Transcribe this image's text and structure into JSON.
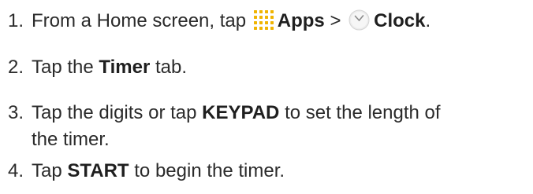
{
  "steps": [
    {
      "number": "1.",
      "text_before": "From a Home screen, tap",
      "apps_icon": "apps-grid-icon",
      "apps_label": "Apps",
      "separator": ">",
      "clock_icon": "clock-icon",
      "clock_label": "Clock",
      "text_after": "."
    },
    {
      "number": "2.",
      "text_before": "Tap the",
      "bold": "Timer",
      "text_after": "tab."
    },
    {
      "number": "3.",
      "text_before": "Tap the digits or tap",
      "bold": "KEYPAD",
      "text_after": "to set the length of",
      "text_line2": "the timer."
    },
    {
      "number": "4.",
      "text_before": "Tap",
      "bold": "START",
      "text_after": "to begin the timer."
    }
  ],
  "colors": {
    "text": "#2b2b2b",
    "apps_icon": "#f0b400",
    "clock_face": "#e6e6e6",
    "clock_hands": "#8a8a8a"
  }
}
